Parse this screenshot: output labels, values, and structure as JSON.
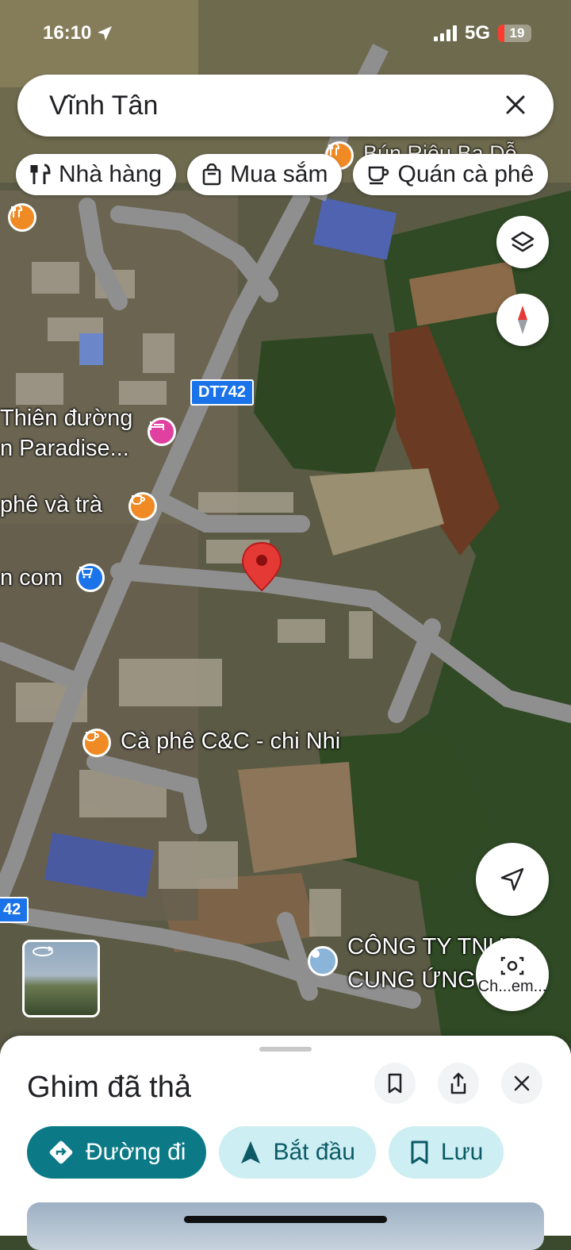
{
  "status_bar": {
    "time": "16:10",
    "network": "5G",
    "battery": "19"
  },
  "search": {
    "query": "Vĩnh Tân"
  },
  "chips": [
    {
      "label": "Nhà hàng",
      "icon": "restaurant-icon"
    },
    {
      "label": "Mua sắm",
      "icon": "shopping-bag-icon"
    },
    {
      "label": "Quán cà phê",
      "icon": "coffee-icon"
    }
  ],
  "map": {
    "road_shields": [
      "DT742",
      "42"
    ],
    "places": [
      {
        "name": "Thiên đường\nn Paradise...",
        "category": "hotel",
        "color": "#e040a0"
      },
      {
        "name": "phê và trà",
        "category": "cafe",
        "color": "#f08a24"
      },
      {
        "name": "n com",
        "category": "shopping",
        "color": "#1a73e8"
      },
      {
        "name": "Cà phê C&C - chi Nhi",
        "category": "cafe",
        "color": "#f08a24"
      },
      {
        "name": "CÔNG TY TNHH\nCUNG ỨNG",
        "category": "place",
        "color": "#8ab4d8"
      }
    ],
    "top_faded_label": "Bún Riêu Ba Dễ",
    "lens_label": "Ch...em...",
    "dropped_pin_color": "#e53935"
  },
  "sheet": {
    "title": "Ghim đã thả",
    "actions": [
      {
        "label": "Đường đi",
        "icon": "directions-icon",
        "style": "primary"
      },
      {
        "label": "Bắt đầu",
        "icon": "navigation-arrow-icon",
        "style": "secondary"
      },
      {
        "label": "Lưu",
        "icon": "bookmark-icon",
        "style": "secondary"
      }
    ]
  }
}
